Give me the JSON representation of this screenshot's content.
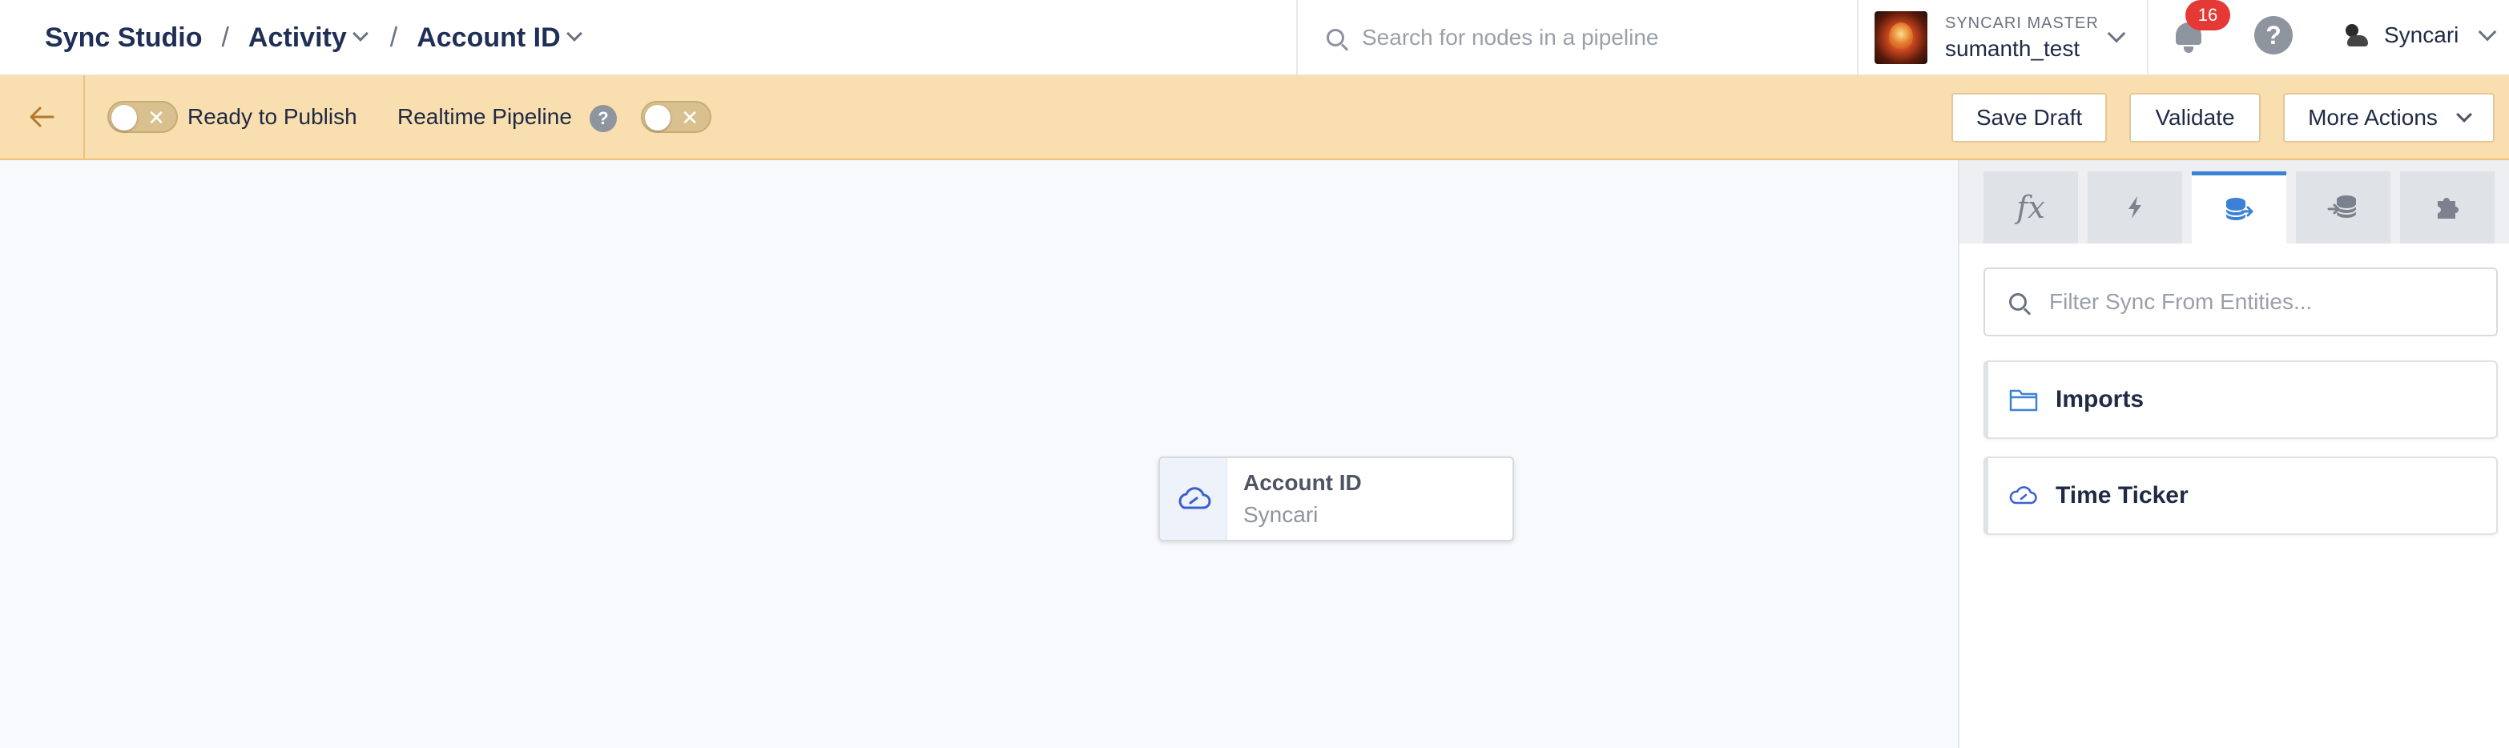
{
  "breadcrumb": {
    "root": "Sync Studio",
    "separator": "/",
    "activity": "Activity",
    "entity": "Account ID"
  },
  "search": {
    "placeholder": "Search for nodes in a pipeline"
  },
  "account": {
    "label": "SYNCARI MASTER",
    "name": "sumanth_test"
  },
  "notifications": {
    "count": "16"
  },
  "help": {
    "glyph": "?"
  },
  "org": {
    "name": "Syncari"
  },
  "toolbar": {
    "ready_label": "Ready to Publish",
    "realtime_label": "Realtime Pipeline",
    "help_glyph": "?",
    "toggle_off_glyph": "✕",
    "save_draft": "Save Draft",
    "validate": "Validate",
    "more_actions": "More Actions"
  },
  "canvas": {
    "node": {
      "title": "Account ID",
      "subtitle": "Syncari",
      "icon": "cloud-icon"
    }
  },
  "panel": {
    "tabs": [
      {
        "icon": "fx-icon",
        "glyph": "fx",
        "active": false
      },
      {
        "icon": "lightning-icon",
        "active": false
      },
      {
        "icon": "database-sync-from-icon",
        "active": true
      },
      {
        "icon": "database-sync-to-icon",
        "active": false
      },
      {
        "icon": "puzzle-icon",
        "active": false
      }
    ],
    "filter_placeholder": "Filter Sync From Entities...",
    "items": [
      {
        "label": "Imports",
        "icon": "folder-icon"
      },
      {
        "label": "Time Ticker",
        "icon": "cloud-icon"
      }
    ]
  },
  "colors": {
    "toolbar_bg": "#f9deaf",
    "accent_blue": "#3b82d6",
    "badge_red": "#e53935",
    "brand_navy": "#1f2f55"
  }
}
